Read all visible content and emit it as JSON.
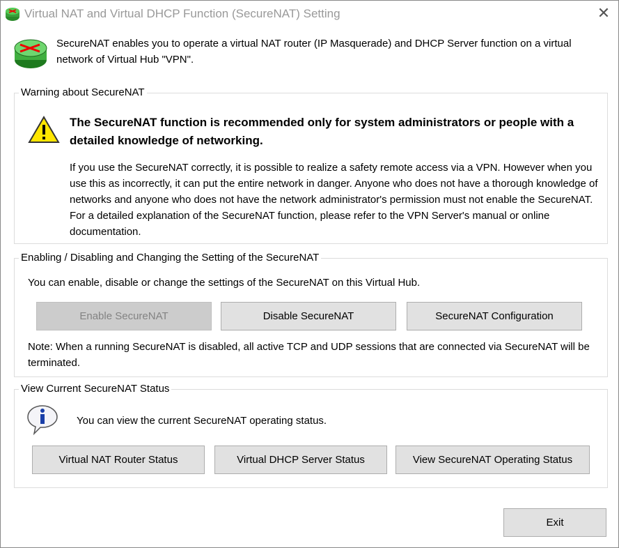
{
  "window": {
    "title": "Virtual NAT and Virtual DHCP Function (SecureNAT) Setting",
    "close": "✕"
  },
  "intro": "SecureNAT enables you to operate a virtual NAT router (IP Masquerade) and DHCP Server function on a virtual network of Virtual Hub \"VPN\".",
  "warning": {
    "legend": "Warning about SecureNAT",
    "heading": "The SecureNAT function is recommended only for system administrators or people with a detailed knowledge of networking.",
    "body": "If you use the SecureNAT correctly, it is possible to realize a safety remote access via a VPN. However when you use this as incorrectly, it can put the entire network in danger. Anyone who does not have a thorough knowledge of networks and anyone who does not have the network administrator's permission must not enable the SecureNAT. For a detailed explanation of the SecureNAT function, please refer to the VPN Server's manual or online documentation."
  },
  "settings": {
    "legend": "Enabling / Disabling and Changing the Setting of the SecureNAT",
    "desc": "You can enable, disable or change the settings of the SecureNAT on this Virtual Hub.",
    "enable": "Enable SecureNAT",
    "disable": "Disable SecureNAT",
    "config": "SecureNAT Configuration",
    "note": "Note: When a running SecureNAT is disabled, all active TCP and UDP sessions that are connected via SecureNAT will be terminated."
  },
  "status": {
    "legend": "View Current SecureNAT Status",
    "desc": "You can view the current SecureNAT operating status.",
    "nat": "Virtual NAT Router Status",
    "dhcp": "Virtual DHCP Server Status",
    "operating": "View SecureNAT Operating Status"
  },
  "exit": "Exit"
}
